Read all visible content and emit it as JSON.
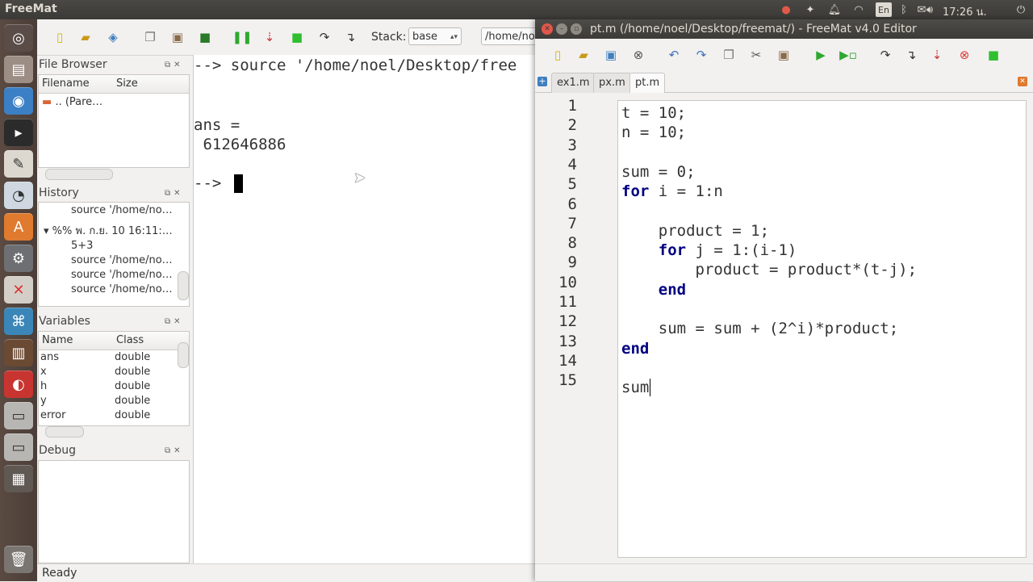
{
  "top_panel": {
    "app_name": "FreeMat",
    "keyboard_layout": "En",
    "clock": "17:26 น.",
    "tray_icons": [
      "record-icon",
      "dropbox-icon",
      "bell-icon",
      "wifi-icon",
      "keyboard-icon",
      "bluetooth-icon",
      "mail-icon",
      "volume-icon"
    ]
  },
  "launcher": {
    "items": [
      "dash-icon",
      "files-icon",
      "chromium-icon",
      "terminal-icon",
      "text-editor-icon",
      "disk-usage-icon",
      "software-center-icon",
      "system-settings-icon",
      "xmind-icon",
      "freemat-icon",
      "bookshelf-icon",
      "presentation-icon",
      "drive-icon",
      "drive-icon-2",
      "workspace-icon",
      "trash-icon"
    ]
  },
  "main_toolbar": {
    "stack_label": "Stack:",
    "stack_value": "base",
    "directory": "/home/no"
  },
  "file_browser": {
    "title": "File Browser",
    "columns": [
      "Filename",
      "Size"
    ],
    "rows": [
      ".. (Pare…"
    ]
  },
  "history": {
    "title": "History",
    "rows": [
      "source '/home/no…",
      "%% พ. ก.ย. 10 16:11:…",
      "5+3",
      "source '/home/no…",
      "source '/home/no…",
      "source '/home/no…"
    ]
  },
  "variables": {
    "title": "Variables",
    "columns": [
      "Name",
      "Class"
    ],
    "rows": [
      {
        "name": "ans",
        "class": "double"
      },
      {
        "name": "x",
        "class": "double"
      },
      {
        "name": "h",
        "class": "double"
      },
      {
        "name": "y",
        "class": "double"
      },
      {
        "name": "error",
        "class": "double"
      }
    ]
  },
  "debug": {
    "title": "Debug"
  },
  "console": {
    "lines": [
      "--> source '/home/noel/Desktop/free",
      "ans =",
      " 612646886",
      "--> "
    ]
  },
  "status": "Ready",
  "editor": {
    "title": "pt.m (/home/noel/Desktop/freemat/) - FreeMat v4.0 Editor",
    "tabs": [
      "ex1.m",
      "px.m",
      "pt.m"
    ],
    "active_tab": "pt.m",
    "line_numbers": [
      "1",
      "2",
      "3",
      "4",
      "5",
      "6",
      "7",
      "8",
      "9",
      "10",
      "11",
      "12",
      "13",
      "14",
      "15"
    ],
    "code_lines": [
      {
        "kw": "",
        "rest": "t = 10;"
      },
      {
        "kw": "",
        "rest": "n = 10;"
      },
      {
        "kw": "",
        "rest": ""
      },
      {
        "kw": "",
        "rest": "sum = 0;"
      },
      {
        "kw": "for",
        "rest": " i = 1:n"
      },
      {
        "kw": "",
        "rest": ""
      },
      {
        "kw": "",
        "rest": "    product = 1;"
      },
      {
        "kw": "    for",
        "rest": " j = 1:(i-1)"
      },
      {
        "kw": "",
        "rest": "        product = product*(t-j);"
      },
      {
        "kw": "    end",
        "rest": ""
      },
      {
        "kw": "",
        "rest": ""
      },
      {
        "kw": "",
        "rest": "    sum = sum + (2^i)*product;"
      },
      {
        "kw": "end",
        "rest": ""
      },
      {
        "kw": "",
        "rest": ""
      },
      {
        "kw": "",
        "rest": "sum"
      }
    ]
  }
}
